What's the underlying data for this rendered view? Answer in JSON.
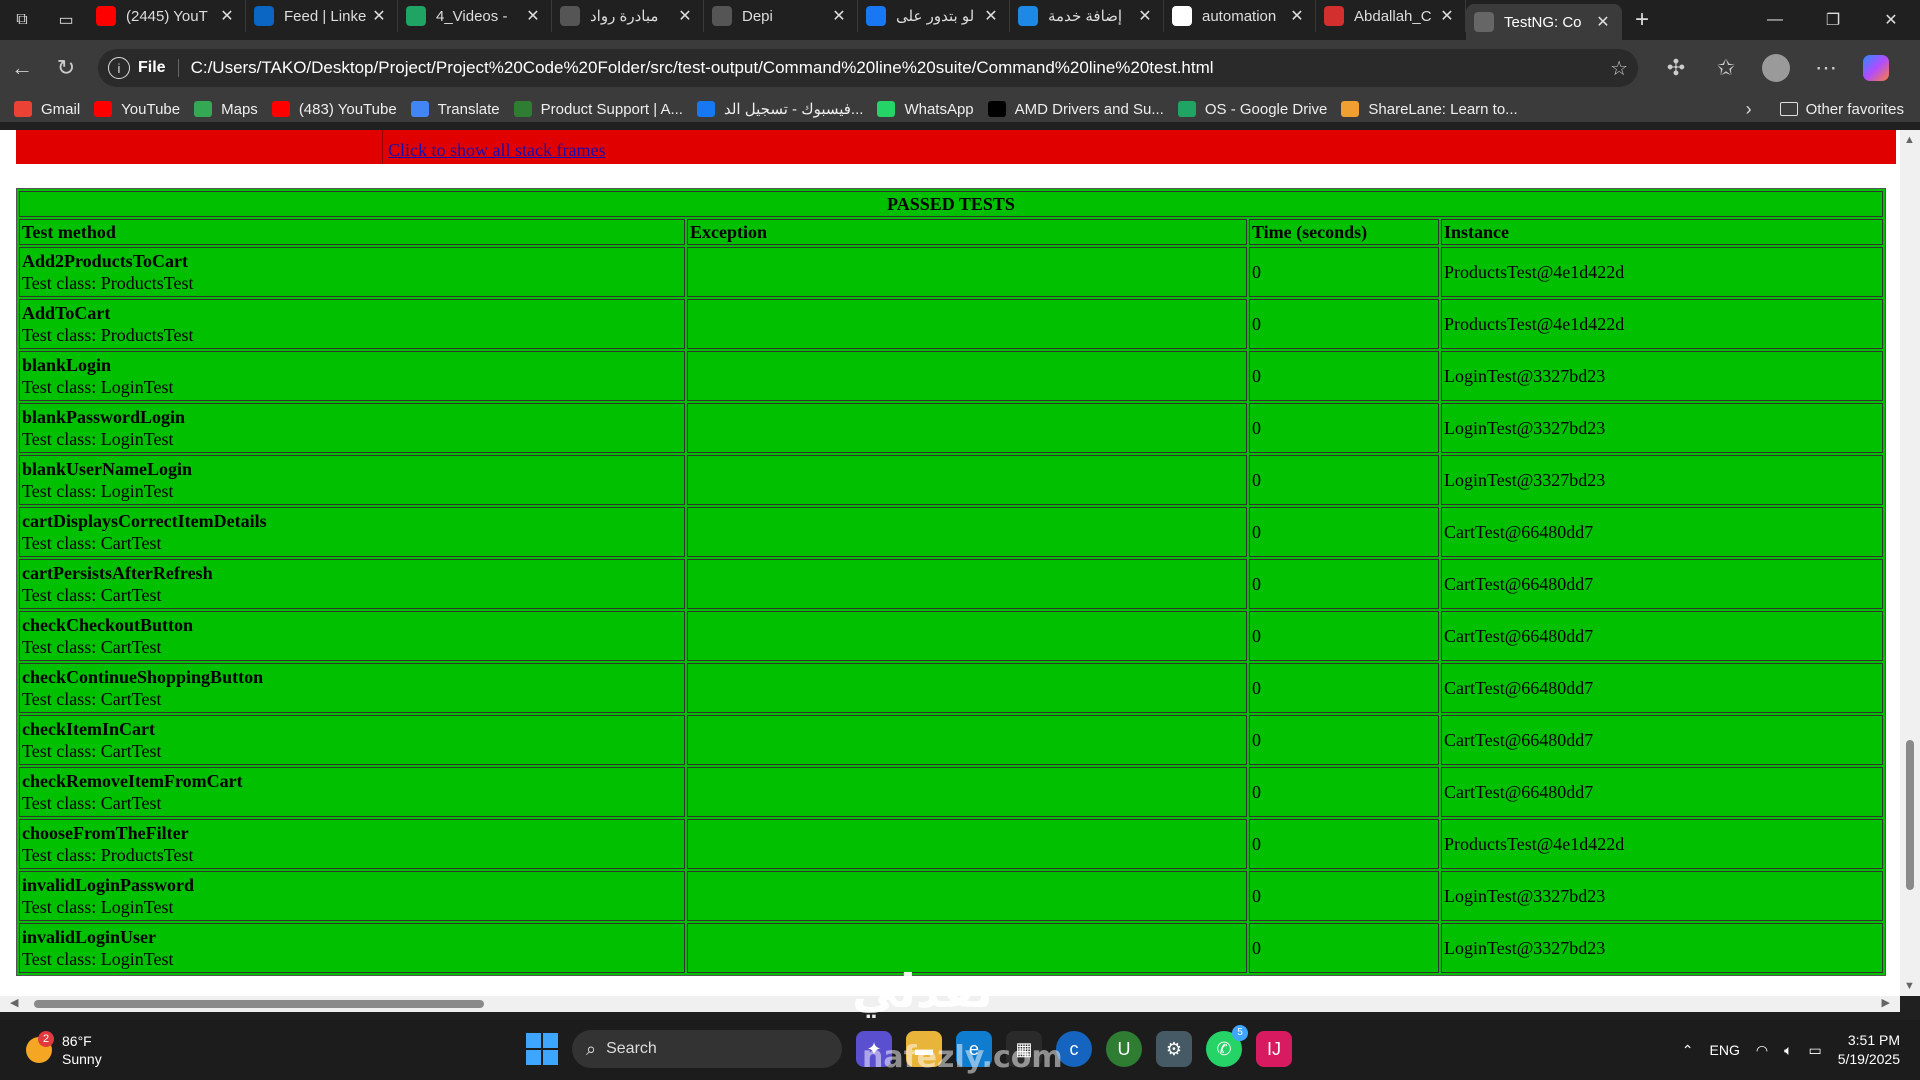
{
  "tabs": [
    {
      "title": "(2445) YouT",
      "icon": "youtube-icon",
      "color": "#ff0000"
    },
    {
      "title": "Feed | Linke",
      "icon": "linkedin-icon",
      "color": "#0a66c2"
    },
    {
      "title": "4_Videos -",
      "icon": "google-drive-icon",
      "color": "#1fa463"
    },
    {
      "title": "مبادرة رواد",
      "icon": "site-icon",
      "color": "#555555"
    },
    {
      "title": "Depi",
      "icon": "site-icon",
      "color": "#555555"
    },
    {
      "title": "لو بتدور على",
      "icon": "facebook-icon",
      "color": "#1877f2"
    },
    {
      "title": "إضافة خدمة",
      "icon": "site-icon",
      "color": "#1e88e5"
    },
    {
      "title": "automation",
      "icon": "google-icon",
      "color": "#ffffff"
    },
    {
      "title": "Abdallah_C",
      "icon": "pdf-icon",
      "color": "#d32f2f"
    },
    {
      "title": "TestNG: Co",
      "icon": "globe-icon",
      "color": "#666666",
      "active": true
    }
  ],
  "address": {
    "scheme": "File",
    "url": "C:/Users/TAKO/Desktop/Project/Project%20Code%20Folder/src/test-output/Command%20line%20suite/Command%20line%20test.html"
  },
  "bookmarks": [
    {
      "label": "Gmail",
      "icon": "gmail-icon",
      "color": "#ea4335"
    },
    {
      "label": "YouTube",
      "icon": "youtube-icon",
      "color": "#ff0000"
    },
    {
      "label": "Maps",
      "icon": "maps-icon",
      "color": "#34a853"
    },
    {
      "label": "(483) YouTube",
      "icon": "youtube-icon",
      "color": "#ff0000"
    },
    {
      "label": "Translate",
      "icon": "translate-icon",
      "color": "#4285f4"
    },
    {
      "label": "Product Support | A...",
      "icon": "support-icon",
      "color": "#2e7d32"
    },
    {
      "label": "فيسبوك - تسجيل الد...",
      "icon": "facebook-icon",
      "color": "#1877f2"
    },
    {
      "label": "WhatsApp",
      "icon": "whatsapp-icon",
      "color": "#25d366"
    },
    {
      "label": "AMD Drivers and Su...",
      "icon": "amd-icon",
      "color": "#000000"
    },
    {
      "label": "OS - Google Drive",
      "icon": "google-drive-icon",
      "color": "#1fa463"
    },
    {
      "label": "ShareLane: Learn to...",
      "icon": "sharelane-icon",
      "color": "#f0a030"
    }
  ],
  "other_favorites": "Other favorites",
  "stack_link": "Click to show all stack frames",
  "results": {
    "caption": "PASSED TESTS",
    "headers": [
      "Test method",
      "Exception",
      "Time (seconds)",
      "Instance"
    ],
    "rows": [
      {
        "method": "Add2ProductsToCart",
        "cls": "Test class: ProductsTest",
        "time": "0",
        "instance": "ProductsTest@4e1d422d"
      },
      {
        "method": "AddToCart",
        "cls": "Test class: ProductsTest",
        "time": "0",
        "instance": "ProductsTest@4e1d422d"
      },
      {
        "method": "blankLogin",
        "cls": "Test class: LoginTest",
        "time": "0",
        "instance": "LoginTest@3327bd23"
      },
      {
        "method": "blankPasswordLogin",
        "cls": "Test class: LoginTest",
        "time": "0",
        "instance": "LoginTest@3327bd23"
      },
      {
        "method": "blankUserNameLogin",
        "cls": "Test class: LoginTest",
        "time": "0",
        "instance": "LoginTest@3327bd23"
      },
      {
        "method": "cartDisplaysCorrectItemDetails",
        "cls": "Test class: CartTest",
        "time": "0",
        "instance": "CartTest@66480dd7"
      },
      {
        "method": "cartPersistsAfterRefresh",
        "cls": "Test class: CartTest",
        "time": "0",
        "instance": "CartTest@66480dd7"
      },
      {
        "method": "checkCheckoutButton",
        "cls": "Test class: CartTest",
        "time": "0",
        "instance": "CartTest@66480dd7"
      },
      {
        "method": "checkContinueShoppingButton",
        "cls": "Test class: CartTest",
        "time": "0",
        "instance": "CartTest@66480dd7"
      },
      {
        "method": "checkItemInCart",
        "cls": "Test class: CartTest",
        "time": "0",
        "instance": "CartTest@66480dd7"
      },
      {
        "method": "checkRemoveItemFromCart",
        "cls": "Test class: CartTest",
        "time": "0",
        "instance": "CartTest@66480dd7"
      },
      {
        "method": "chooseFromTheFilter",
        "cls": "Test class: ProductsTest",
        "time": "0",
        "instance": "ProductsTest@4e1d422d"
      },
      {
        "method": "invalidLoginPassword",
        "cls": "Test class: LoginTest",
        "time": "0",
        "instance": "LoginTest@3327bd23"
      },
      {
        "method": "invalidLoginUser",
        "cls": "Test class: LoginTest",
        "time": "0",
        "instance": "LoginTest@3327bd23"
      }
    ]
  },
  "taskbar": {
    "weather_temp": "86°F",
    "weather_desc": "Sunny",
    "weather_badge": "2",
    "search_label": "Search",
    "whatsapp_badge": "5",
    "lang": "ENG",
    "time": "3:51 PM",
    "date": "5/19/2025"
  },
  "watermark": "نفذلي",
  "watermark_latin": "nafezly.com"
}
